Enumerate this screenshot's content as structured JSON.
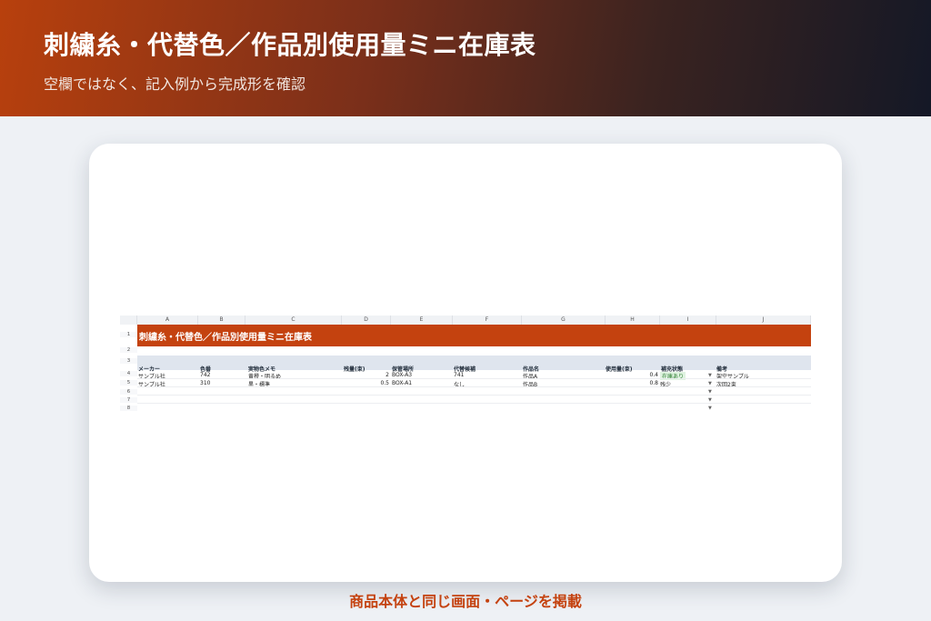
{
  "hero": {
    "title": "刺繍糸・代替色／作品別使用量ミニ在庫表",
    "subtitle": "空欄ではなく、記入例から完成形を確認"
  },
  "caption": "商品本体と同じ画面・ページを掲載",
  "sheet": {
    "columns": [
      "A",
      "B",
      "C",
      "D",
      "E",
      "F",
      "G",
      "H",
      "I",
      "J"
    ],
    "rows": [
      "1",
      "2",
      "3",
      "4",
      "5",
      "6",
      "7",
      "8"
    ],
    "title": "刺繍糸・代替色／作品別使用量ミニ在庫表",
    "headers": [
      "メーカー",
      "色番",
      "実物色メモ",
      "残量(束)",
      "保管場所",
      "代替候補",
      "作品名",
      "使用量(束)",
      "補充状態",
      "備考"
    ],
    "data_rows": [
      [
        "サンプル社",
        "742",
        "黄橙・明るめ",
        "2",
        "BOX-A3",
        "741",
        "作品A",
        "0.4",
        "在庫あり",
        "架空サンプル"
      ],
      [
        "サンプル社",
        "310",
        "黒・標準",
        "0.5",
        "BOX-A1",
        "なし",
        "作品B",
        "0.8",
        "残少",
        "次回2束"
      ]
    ],
    "dropdown_arrow": "▼"
  },
  "colors": {
    "accent": "#c4420f",
    "header_band": "#dfe5ee",
    "ok_status": "#2e7d32"
  }
}
